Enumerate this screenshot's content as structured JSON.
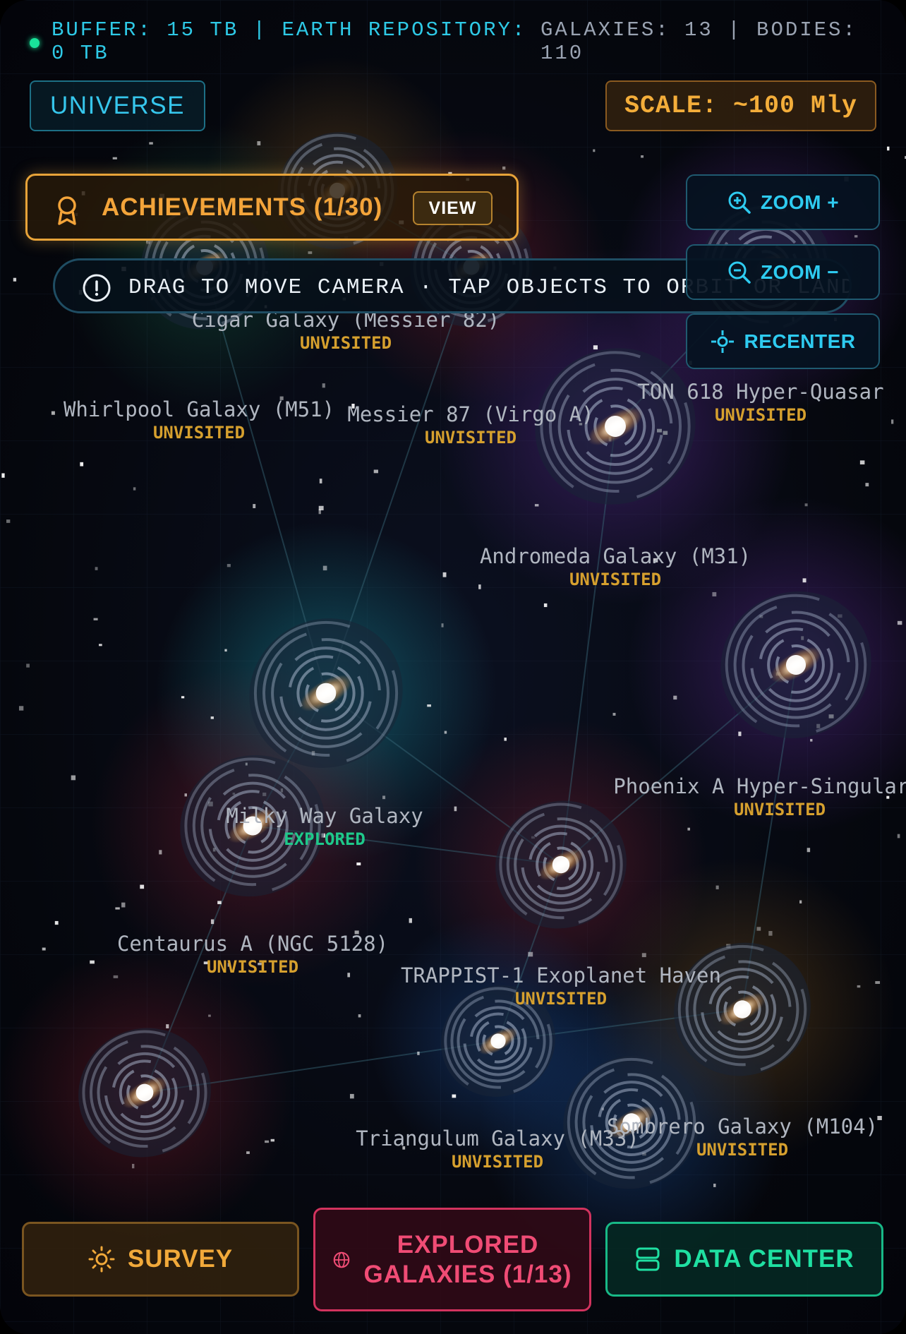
{
  "status_bar": {
    "buffer_text": "BUFFER: 15 TB | EARTH REPOSITORY: 0 TB",
    "counts_text": "GALAXIES: 13 | BODIES: 110"
  },
  "universe_button": "UNIVERSE",
  "scale_badge": "SCALE: ~100 Mly",
  "achievements": {
    "label": "ACHIEVEMENTS (1/30)",
    "view_label": "VIEW"
  },
  "hint": "DRAG TO MOVE CAMERA · TAP OBJECTS TO ORBIT OR LAND",
  "zoom_controls": {
    "zoom_in": "ZOOM +",
    "zoom_out": "ZOOM −",
    "recenter": "RECENTER"
  },
  "galaxies": [
    {
      "name": "Cigar Galaxy (Messier 82)",
      "status": "UNVISITED",
      "explored": false
    },
    {
      "name": "Whirlpool Galaxy (M51)",
      "status": "UNVISITED",
      "explored": false
    },
    {
      "name": "Messier 87 (Virgo A)",
      "status": "UNVISITED",
      "explored": false
    },
    {
      "name": "TON 618 Hyper-Quasar",
      "status": "UNVISITED",
      "explored": false
    },
    {
      "name": "Andromeda Galaxy (M31)",
      "status": "UNVISITED",
      "explored": false
    },
    {
      "name": "Phoenix A Hyper-Singularity",
      "status": "UNVISITED",
      "explored": false
    },
    {
      "name": "Milky Way Galaxy",
      "status": "EXPLORED",
      "explored": true
    },
    {
      "name": "Centaurus A (NGC 5128)",
      "status": "UNVISITED",
      "explored": false
    },
    {
      "name": "TRAPPIST-1 Exoplanet Haven",
      "status": "UNVISITED",
      "explored": false
    },
    {
      "name": "Triangulum Galaxy (M33)",
      "status": "UNVISITED",
      "explored": false
    },
    {
      "name": "Sombrero Galaxy (M104)",
      "status": "UNVISITED",
      "explored": false
    }
  ],
  "bottom_bar": {
    "survey": "SURVEY",
    "explored_line1": "EXPLORED",
    "explored_line2": "GALAXIES (1/13)",
    "data_center": "DATA CENTER"
  },
  "colors": {
    "accent_cyan": "#2ec9e6",
    "accent_amber": "#f3a43a",
    "accent_pink": "#f04c75",
    "accent_green": "#1fe0a2",
    "status_dot": "#19e39a"
  }
}
